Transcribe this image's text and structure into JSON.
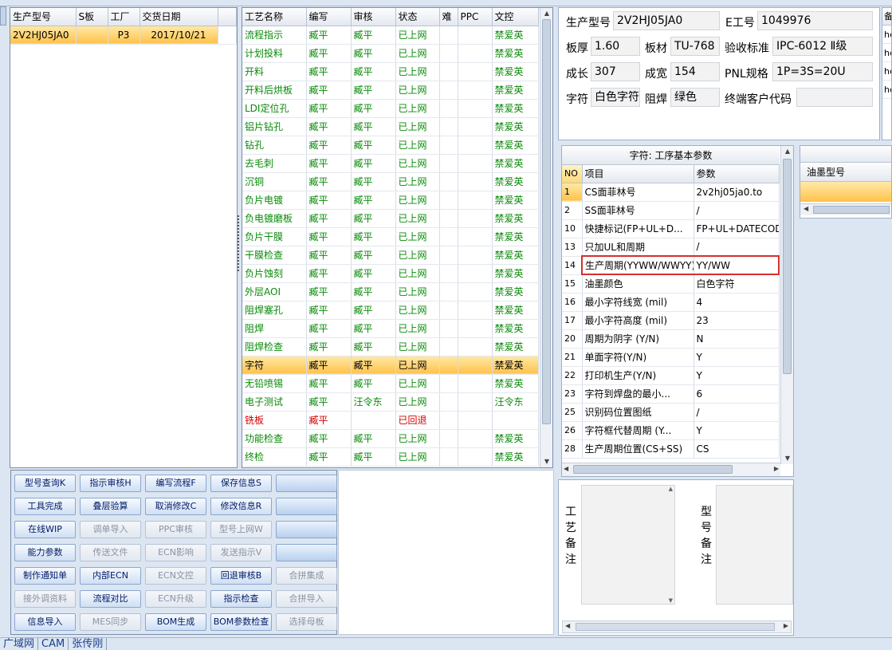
{
  "left_list": {
    "headers": [
      "生产型号",
      "S板",
      "工厂",
      "交货日期"
    ],
    "rows": [
      [
        "2V2HJ05JA0",
        "",
        "P3",
        "2017/10/21"
      ]
    ]
  },
  "process_table": {
    "headers": [
      "工艺名称",
      "编写",
      "审核",
      "状态",
      "难",
      "PPC",
      "文控"
    ],
    "rows": [
      [
        "流程指示",
        "臧平",
        "臧平",
        "已上网",
        "",
        "",
        "禁爱英"
      ],
      [
        "计划投料",
        "臧平",
        "臧平",
        "已上网",
        "",
        "",
        "禁爱英"
      ],
      [
        "开料",
        "臧平",
        "臧平",
        "已上网",
        "",
        "",
        "禁爱英"
      ],
      [
        "开料后烘板",
        "臧平",
        "臧平",
        "已上网",
        "",
        "",
        "禁爱英"
      ],
      [
        "LDI定位孔",
        "臧平",
        "臧平",
        "已上网",
        "",
        "",
        "禁爱英"
      ],
      [
        "铝片钻孔",
        "臧平",
        "臧平",
        "已上网",
        "",
        "",
        "禁爱英"
      ],
      [
        "钻孔",
        "臧平",
        "臧平",
        "已上网",
        "",
        "",
        "禁爱英"
      ],
      [
        "去毛刺",
        "臧平",
        "臧平",
        "已上网",
        "",
        "",
        "禁爱英"
      ],
      [
        "沉铜",
        "臧平",
        "臧平",
        "已上网",
        "",
        "",
        "禁爱英"
      ],
      [
        "负片电镀",
        "臧平",
        "臧平",
        "已上网",
        "",
        "",
        "禁爱英"
      ],
      [
        "负电镀磨板",
        "臧平",
        "臧平",
        "已上网",
        "",
        "",
        "禁爱英"
      ],
      [
        "负片干膜",
        "臧平",
        "臧平",
        "已上网",
        "",
        "",
        "禁爱英"
      ],
      [
        "干膜检查",
        "臧平",
        "臧平",
        "已上网",
        "",
        "",
        "禁爱英"
      ],
      [
        "负片蚀刻",
        "臧平",
        "臧平",
        "已上网",
        "",
        "",
        "禁爱英"
      ],
      [
        "外层AOI",
        "臧平",
        "臧平",
        "已上网",
        "",
        "",
        "禁爱英"
      ],
      [
        "阻焊塞孔",
        "臧平",
        "臧平",
        "已上网",
        "",
        "",
        "禁爱英"
      ],
      [
        "阻焊",
        "臧平",
        "臧平",
        "已上网",
        "",
        "",
        "禁爱英"
      ],
      [
        "阻焊检查",
        "臧平",
        "臧平",
        "已上网",
        "",
        "",
        "禁爱英"
      ],
      [
        "字符",
        "臧平",
        "臧平",
        "已上网",
        "",
        "",
        "禁爱英"
      ],
      [
        "无铅喷锡",
        "臧平",
        "臧平",
        "已上网",
        "",
        "",
        "禁爱英"
      ],
      [
        "电子测试",
        "臧平",
        "汪令东",
        "已上网",
        "",
        "",
        "汪令东"
      ],
      [
        "铣板",
        "臧平",
        "",
        "已回退",
        "",
        "",
        ""
      ],
      [
        "功能检查",
        "臧平",
        "臧平",
        "已上网",
        "",
        "",
        "禁爱英"
      ],
      [
        "终检",
        "臧平",
        "臧平",
        "已上网",
        "",
        "",
        "禁爱英"
      ]
    ],
    "selected_index": 18,
    "red_index": 21
  },
  "buttons": [
    [
      "型号查询K",
      "指示审核H",
      "编写流程F",
      "保存信息S",
      ""
    ],
    [
      "工具完成",
      "叠层验算",
      "取消修改C",
      "修改信息R",
      ""
    ],
    [
      "在线WIP",
      "调单导入",
      "PPC审核",
      "型号上网W",
      ""
    ],
    [
      "能力参数",
      "传送文件",
      "ECN影响",
      "发送指示V",
      ""
    ],
    [
      "制作通知单",
      "内部ECN",
      "ECN文控",
      "回退审核B",
      "合拼集成"
    ],
    [
      "接外调资料",
      "流程对比",
      "ECN升级",
      "指示检查",
      "合拼导入"
    ],
    [
      "信息导入",
      "MES同步",
      "BOM生成",
      "BOM参数检查",
      "选择母板"
    ]
  ],
  "buttons_disabled": [
    [
      false,
      false,
      false,
      false,
      false
    ],
    [
      false,
      false,
      false,
      false,
      false
    ],
    [
      false,
      true,
      true,
      true,
      false
    ],
    [
      false,
      true,
      true,
      true,
      false
    ],
    [
      false,
      false,
      true,
      false,
      true
    ],
    [
      true,
      false,
      true,
      false,
      true
    ],
    [
      false,
      true,
      false,
      false,
      true
    ]
  ],
  "info": {
    "prod_model_label": "生产型号",
    "prod_model": "2V2HJ05JA0",
    "e_no_label": "E工号",
    "e_no": "1049976",
    "thickness_label": "板厚",
    "thickness": "1.60",
    "material_label": "板材",
    "material": "TU-768",
    "standard_label": "验收标准",
    "standard": "IPC-6012 Ⅱ级",
    "length_label": "成长",
    "length": "307",
    "width_label": "成宽",
    "width": "154",
    "pnl_label": "PNL规格",
    "pnl": "1P=3S=20U",
    "char_label": "字符",
    "char": "白色字符",
    "mask_label": "阻焊",
    "mask": "绿色",
    "customer_code_label": "终端客户代码",
    "customer_code": ""
  },
  "right_partial_col": {
    "header": "备",
    "rows": [
      "he",
      "he",
      "he",
      "he"
    ]
  },
  "param_table": {
    "title": "字符: 工序基本参数",
    "headers": [
      "NO",
      "项目",
      "参数"
    ],
    "rows": [
      [
        "1",
        "CS面菲林号",
        "2v2hj05ja0.to"
      ],
      [
        "2",
        "SS面菲林号",
        "/"
      ],
      [
        "10",
        "快捷标记(FP+UL+D...",
        "FP+UL+DATECODE"
      ],
      [
        "13",
        "只加UL和周期",
        "/"
      ],
      [
        "14",
        "生产周期(YYWW/WWYY)",
        "YY/WW"
      ],
      [
        "15",
        "油墨颜色",
        "白色字符"
      ],
      [
        "16",
        "最小字符线宽 (mil)",
        "4"
      ],
      [
        "17",
        "最小字符高度 (mil)",
        "23"
      ],
      [
        "20",
        "周期为阴字 (Y/N)",
        "N"
      ],
      [
        "21",
        "单面字符(Y/N)",
        "Y"
      ],
      [
        "22",
        "打印机生产(Y/N)",
        "Y"
      ],
      [
        "23",
        "字符到焊盘的最小...",
        "6"
      ],
      [
        "25",
        "识别码位置图纸",
        "/"
      ],
      [
        "26",
        "字符框代替周期 (Y...",
        "Y"
      ],
      [
        "28",
        "生产周期位置(CS+SS)",
        "CS"
      ]
    ],
    "highlight_index": 4
  },
  "ink_panel": {
    "header": "油墨型号"
  },
  "remarks": {
    "process_label": "工艺备注",
    "model_label": "型号备注"
  },
  "status_bar": [
    "广域网",
    "CAM",
    "张传刚"
  ]
}
